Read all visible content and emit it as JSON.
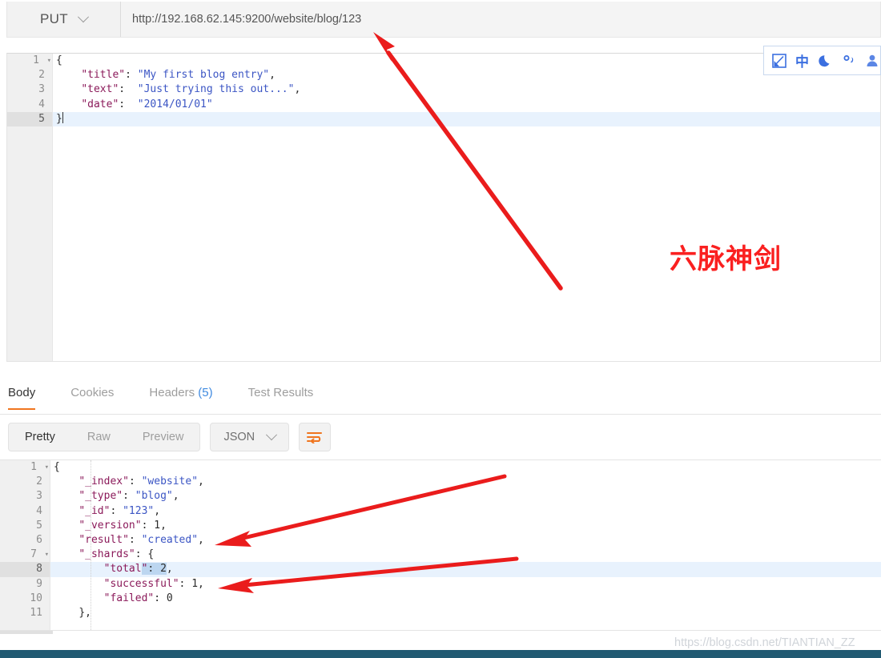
{
  "request": {
    "method": "PUT",
    "method_caret": "chevron-down",
    "url": "http://192.168.62.145:9200/website/blog/123",
    "body_lines": [
      {
        "num": "1",
        "fold": "▾",
        "active": false,
        "tokens": [
          {
            "t": "{",
            "c": "p"
          }
        ]
      },
      {
        "num": "2",
        "fold": "",
        "active": false,
        "tokens": [
          {
            "t": "    ",
            "c": "p"
          },
          {
            "t": "\"title\"",
            "c": "k"
          },
          {
            "t": ": ",
            "c": "p"
          },
          {
            "t": "\"My first blog entry\"",
            "c": "s"
          },
          {
            "t": ",",
            "c": "p"
          }
        ]
      },
      {
        "num": "3",
        "fold": "",
        "active": false,
        "tokens": [
          {
            "t": "    ",
            "c": "p"
          },
          {
            "t": "\"text\"",
            "c": "k"
          },
          {
            "t": ":  ",
            "c": "p"
          },
          {
            "t": "\"Just trying this out...\"",
            "c": "s"
          },
          {
            "t": ",",
            "c": "p"
          }
        ]
      },
      {
        "num": "4",
        "fold": "",
        "active": false,
        "tokens": [
          {
            "t": "    ",
            "c": "p"
          },
          {
            "t": "\"date\"",
            "c": "k"
          },
          {
            "t": ":  ",
            "c": "p"
          },
          {
            "t": "\"2014/01/01\"",
            "c": "s"
          }
        ]
      },
      {
        "num": "5",
        "fold": "",
        "active": true,
        "tokens": [
          {
            "t": "}",
            "c": "p"
          }
        ],
        "caret": true
      }
    ]
  },
  "response": {
    "tabs": [
      {
        "label": "Body",
        "active": true,
        "count": ""
      },
      {
        "label": "Cookies",
        "active": false,
        "count": ""
      },
      {
        "label": "Headers",
        "active": false,
        "count": "(5)"
      },
      {
        "label": "Test Results",
        "active": false,
        "count": ""
      }
    ],
    "view_modes": [
      {
        "label": "Pretty",
        "active": true
      },
      {
        "label": "Raw",
        "active": false
      },
      {
        "label": "Preview",
        "active": false
      }
    ],
    "format_select": "JSON",
    "format_caret": "chevron-down",
    "wrap_button": "wrap-lines",
    "body_lines": [
      {
        "num": "1",
        "fold": "▾",
        "active": false,
        "tokens": [
          {
            "t": "{",
            "c": "p"
          }
        ]
      },
      {
        "num": "2",
        "fold": "",
        "active": false,
        "tokens": [
          {
            "t": "    ",
            "c": "p"
          },
          {
            "t": "\"_index\"",
            "c": "k"
          },
          {
            "t": ": ",
            "c": "p"
          },
          {
            "t": "\"website\"",
            "c": "s"
          },
          {
            "t": ",",
            "c": "p"
          }
        ]
      },
      {
        "num": "3",
        "fold": "",
        "active": false,
        "tokens": [
          {
            "t": "    ",
            "c": "p"
          },
          {
            "t": "\"_type\"",
            "c": "k"
          },
          {
            "t": ": ",
            "c": "p"
          },
          {
            "t": "\"blog\"",
            "c": "s"
          },
          {
            "t": ",",
            "c": "p"
          }
        ]
      },
      {
        "num": "4",
        "fold": "",
        "active": false,
        "tokens": [
          {
            "t": "    ",
            "c": "p"
          },
          {
            "t": "\"_id\"",
            "c": "k"
          },
          {
            "t": ": ",
            "c": "p"
          },
          {
            "t": "\"123\"",
            "c": "s"
          },
          {
            "t": ",",
            "c": "p"
          }
        ]
      },
      {
        "num": "5",
        "fold": "",
        "active": false,
        "tokens": [
          {
            "t": "    ",
            "c": "p"
          },
          {
            "t": "\"_version\"",
            "c": "k"
          },
          {
            "t": ": ",
            "c": "p"
          },
          {
            "t": "1",
            "c": "n"
          },
          {
            "t": ",",
            "c": "p"
          }
        ]
      },
      {
        "num": "6",
        "fold": "",
        "active": false,
        "tokens": [
          {
            "t": "    ",
            "c": "p"
          },
          {
            "t": "\"result\"",
            "c": "k"
          },
          {
            "t": ": ",
            "c": "p"
          },
          {
            "t": "\"created\"",
            "c": "s"
          },
          {
            "t": ",",
            "c": "p"
          }
        ]
      },
      {
        "num": "7",
        "fold": "▾",
        "active": false,
        "tokens": [
          {
            "t": "    ",
            "c": "p"
          },
          {
            "t": "\"_shards\"",
            "c": "k"
          },
          {
            "t": ": ",
            "c": "p"
          },
          {
            "t": "{",
            "c": "p"
          }
        ]
      },
      {
        "num": "8",
        "fold": "",
        "active": true,
        "tokens": [
          {
            "t": "        ",
            "c": "p"
          },
          {
            "t": "\"total",
            "c": "k"
          },
          {
            "t": "\"",
            "c": "k sel"
          },
          {
            "t": ": ",
            "c": "p sel"
          },
          {
            "t": "2",
            "c": "n sel"
          },
          {
            "t": ",",
            "c": "p"
          }
        ]
      },
      {
        "num": "9",
        "fold": "",
        "active": false,
        "tokens": [
          {
            "t": "        ",
            "c": "p"
          },
          {
            "t": "\"successful\"",
            "c": "k"
          },
          {
            "t": ": ",
            "c": "p"
          },
          {
            "t": "1",
            "c": "n"
          },
          {
            "t": ",",
            "c": "p"
          }
        ]
      },
      {
        "num": "10",
        "fold": "",
        "active": false,
        "tokens": [
          {
            "t": "        ",
            "c": "p"
          },
          {
            "t": "\"failed\"",
            "c": "k"
          },
          {
            "t": ": ",
            "c": "p"
          },
          {
            "t": "0",
            "c": "n"
          }
        ]
      },
      {
        "num": "11",
        "fold": "",
        "active": false,
        "tokens": [
          {
            "t": "    ",
            "c": "p"
          },
          {
            "t": "},",
            "c": "p"
          }
        ]
      }
    ]
  },
  "ime": {
    "items": [
      {
        "name": "sogou-logo-icon",
        "glyph": "logo"
      },
      {
        "name": "chinese-mode-icon",
        "glyph": "中"
      },
      {
        "name": "moon-icon",
        "glyph": "moon"
      },
      {
        "name": "punctuation-mode-icon",
        "glyph": "°,"
      },
      {
        "name": "user-icon",
        "glyph": "person"
      }
    ]
  },
  "annotations": {
    "red_text": "六脉神剑",
    "arrow_color": "#ea1c1c"
  },
  "watermark": "https://blog.csdn.net/TIANTIAN_ZZ",
  "colors": {
    "accent": "#f0751f",
    "link": "#3f8ae0",
    "annotation_red": "#fa2020",
    "taskbar": "#215a72"
  }
}
